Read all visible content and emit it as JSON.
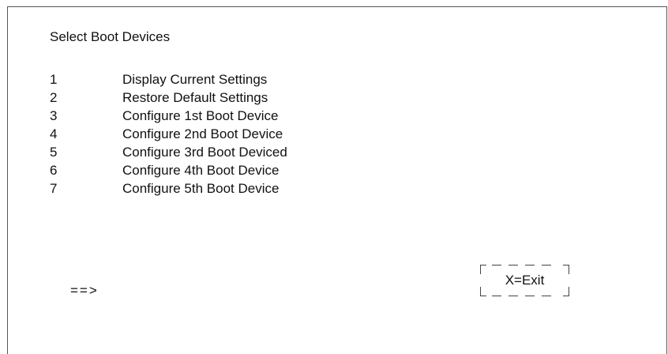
{
  "screen": {
    "title": "Select Boot Devices"
  },
  "menu": {
    "items": [
      {
        "number": "1",
        "label": "Display Current Settings"
      },
      {
        "number": "2",
        "label": "Restore Default Settings"
      },
      {
        "number": "3",
        "label": "Configure 1st Boot Device"
      },
      {
        "number": "4",
        "label": "Configure 2nd Boot Device"
      },
      {
        "number": "5",
        "label": "Configure 3rd Boot Deviced"
      },
      {
        "number": "6",
        "label": "Configure 4th Boot Device"
      },
      {
        "number": "7",
        "label": "Configure 5th Boot Device"
      }
    ]
  },
  "prompt": {
    "arrow_equals": "==",
    "arrow_head": ">"
  },
  "exit": {
    "label": "X=Exit"
  }
}
